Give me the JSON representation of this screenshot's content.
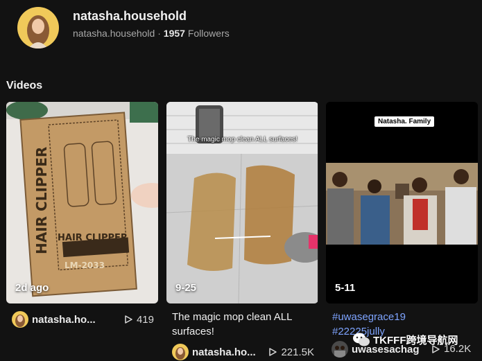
{
  "profile": {
    "name": "natasha.household",
    "handle": "natasha.household",
    "separator": "·",
    "followers_count": "1957",
    "followers_label": "Followers"
  },
  "section_title": "Videos",
  "videos": [
    {
      "date": "2d ago",
      "author": "natasha.ho...",
      "views": "419",
      "thumb_text": [
        "HAIR CLIPPER",
        "HAIR CLIPPER",
        "LM-2033"
      ]
    },
    {
      "date": "9-25",
      "caption_line1": "The magic mop clean ALL",
      "caption_line2": "surfaces!",
      "overlay_text": "The magic mop clean ALL surfaces!",
      "author": "natasha.ho...",
      "views": "221.5K"
    },
    {
      "date": "5-11",
      "overlay_text": "Natasha. Family",
      "tag_line1": "#uwasegrace19",
      "tag_line2": "#22225jully",
      "author": "uwasesachag",
      "views": "16.2K"
    }
  ],
  "watermark": "TKFFF跨境导航网",
  "colors": {
    "background": "#121212",
    "hashtag": "#7ea4ff",
    "muted_text": "#a8a8a8"
  }
}
